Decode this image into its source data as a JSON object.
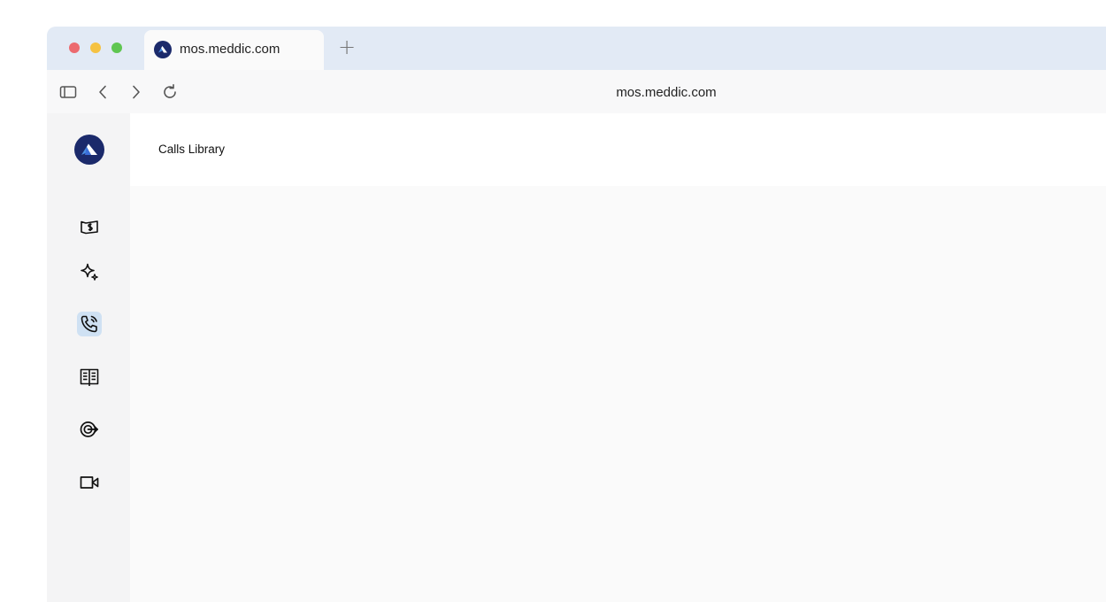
{
  "browser": {
    "tab": {
      "title": "mos.meddic.com",
      "favicon": "meddic-logo-icon"
    },
    "new_tab_label": "+",
    "address_bar": {
      "url": "mos.meddic.com"
    },
    "toolbar_icons": [
      "sidebar-toggle-icon",
      "back-icon",
      "forward-icon",
      "reload-icon"
    ]
  },
  "app": {
    "logo": "meddic-logo-icon",
    "sidebar": {
      "items": [
        {
          "name": "deals",
          "icon": "money-icon",
          "active": false
        },
        {
          "name": "ai",
          "icon": "sparkles-icon",
          "active": false
        },
        {
          "name": "calls",
          "icon": "phone-icon",
          "active": true
        },
        {
          "name": "library",
          "icon": "book-icon",
          "active": false
        },
        {
          "name": "target",
          "icon": "target-icon",
          "active": false
        },
        {
          "name": "video",
          "icon": "video-icon",
          "active": false
        }
      ]
    },
    "page_title": "Calls Library"
  },
  "colors": {
    "tabstrip": "#e2eaf5",
    "active_nav": "#cfe1f3",
    "logo_navy": "#1b2a6b",
    "logo_blue": "#4a90e2",
    "traffic_red": "#ec6a6f",
    "traffic_yellow": "#f5c242",
    "traffic_green": "#5fc651"
  }
}
